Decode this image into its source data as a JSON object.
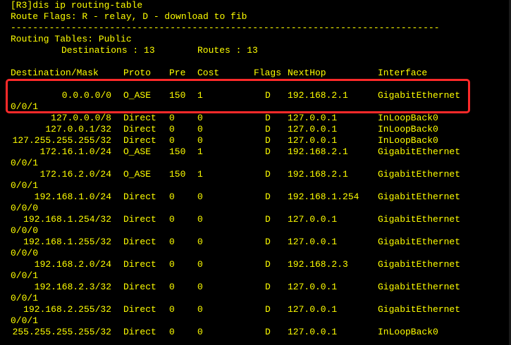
{
  "terminal": {
    "command_line": "[R3]dis ip routing-table",
    "flags_line": "Route Flags: R - relay, D - download to fib",
    "separator": "------------------------------------------------------------------------------",
    "tables_line": "Routing Tables: Public",
    "destinations_label": "Destinations : 13",
    "routes_label": "Routes : 13",
    "headers": {
      "dest": "Destination/Mask",
      "proto": "Proto",
      "pre": "Pre",
      "cost": "Cost",
      "flags": "Flags",
      "nexthop": "NextHop",
      "interface": "Interface"
    },
    "routes": [
      {
        "dest": "0.0.0.0/0",
        "proto": "O_ASE",
        "pre": "150",
        "cost": "1",
        "flags": "D",
        "nexthop": "192.168.2.1",
        "interface": "GigabitEthernet",
        "wrap": "0/0/1"
      },
      {
        "dest": "127.0.0.0/8",
        "proto": "Direct",
        "pre": "0",
        "cost": "0",
        "flags": "D",
        "nexthop": "127.0.0.1",
        "interface": "InLoopBack0",
        "wrap": ""
      },
      {
        "dest": "127.0.0.1/32",
        "proto": "Direct",
        "pre": "0",
        "cost": "0",
        "flags": "D",
        "nexthop": "127.0.0.1",
        "interface": "InLoopBack0",
        "wrap": ""
      },
      {
        "dest": "127.255.255.255/32",
        "proto": "Direct",
        "pre": "0",
        "cost": "0",
        "flags": "D",
        "nexthop": "127.0.0.1",
        "interface": "InLoopBack0",
        "wrap": ""
      },
      {
        "dest": "172.16.1.0/24",
        "proto": "O_ASE",
        "pre": "150",
        "cost": "1",
        "flags": "D",
        "nexthop": "192.168.2.1",
        "interface": "GigabitEthernet",
        "wrap": "0/0/1"
      },
      {
        "dest": "172.16.2.0/24",
        "proto": "O_ASE",
        "pre": "150",
        "cost": "1",
        "flags": "D",
        "nexthop": "192.168.2.1",
        "interface": "GigabitEthernet",
        "wrap": "0/0/1"
      },
      {
        "dest": "192.168.1.0/24",
        "proto": "Direct",
        "pre": "0",
        "cost": "0",
        "flags": "D",
        "nexthop": "192.168.1.254",
        "interface": "GigabitEthernet",
        "wrap": "0/0/0"
      },
      {
        "dest": "192.168.1.254/32",
        "proto": "Direct",
        "pre": "0",
        "cost": "0",
        "flags": "D",
        "nexthop": "127.0.0.1",
        "interface": "GigabitEthernet",
        "wrap": "0/0/0"
      },
      {
        "dest": "192.168.1.255/32",
        "proto": "Direct",
        "pre": "0",
        "cost": "0",
        "flags": "D",
        "nexthop": "127.0.0.1",
        "interface": "GigabitEthernet",
        "wrap": "0/0/0"
      },
      {
        "dest": "192.168.2.0/24",
        "proto": "Direct",
        "pre": "0",
        "cost": "0",
        "flags": "D",
        "nexthop": "192.168.2.3",
        "interface": "GigabitEthernet",
        "wrap": "0/0/1"
      },
      {
        "dest": "192.168.2.3/32",
        "proto": "Direct",
        "pre": "0",
        "cost": "0",
        "flags": "D",
        "nexthop": "127.0.0.1",
        "interface": "GigabitEthernet",
        "wrap": "0/0/1"
      },
      {
        "dest": "192.168.2.255/32",
        "proto": "Direct",
        "pre": "0",
        "cost": "0",
        "flags": "D",
        "nexthop": "127.0.0.1",
        "interface": "GigabitEthernet",
        "wrap": "0/0/1"
      },
      {
        "dest": "255.255.255.255/32",
        "proto": "Direct",
        "pre": "0",
        "cost": "0",
        "flags": "D",
        "nexthop": "127.0.0.1",
        "interface": "InLoopBack0",
        "wrap": ""
      }
    ]
  },
  "colors": {
    "background": "#000000",
    "text": "#ffff00",
    "highlight": "#ff2a2a"
  }
}
